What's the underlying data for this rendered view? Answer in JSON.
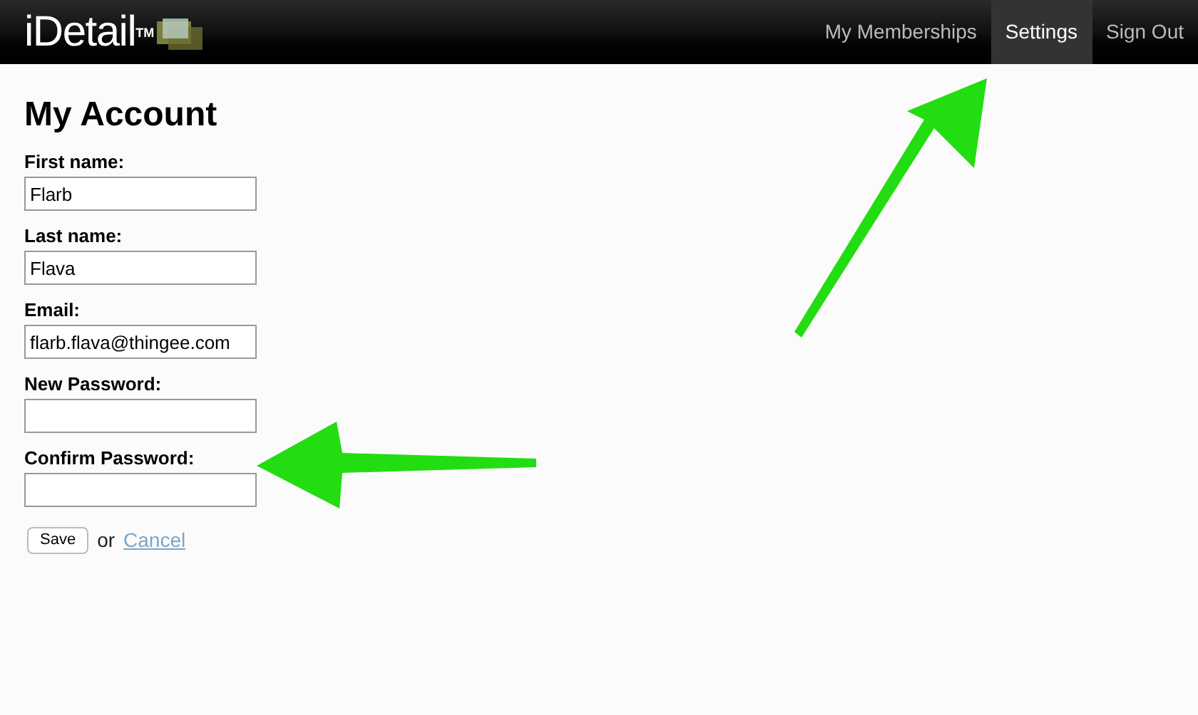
{
  "navbar": {
    "logo": "iDetail",
    "logo_mark": "TM",
    "links": [
      {
        "label": "My Memberships",
        "selected": false
      },
      {
        "label": "Settings",
        "selected": true
      },
      {
        "label": "Sign Out",
        "selected": false
      }
    ]
  },
  "title": "My Account",
  "fields": [
    {
      "label": "First name:",
      "value": "Flarb",
      "kind": "text"
    },
    {
      "label": "Last name:",
      "value": "Flava",
      "kind": "text"
    },
    {
      "label": "Email:",
      "value": "flarb.flava@thingee.com",
      "kind": "text"
    },
    {
      "label": "New Password:",
      "kind": "password"
    },
    {
      "label": "Confirm Password:",
      "kind": "password"
    }
  ],
  "actions": {
    "save": "Save",
    "or": "or",
    "cancel": "Cancel"
  }
}
